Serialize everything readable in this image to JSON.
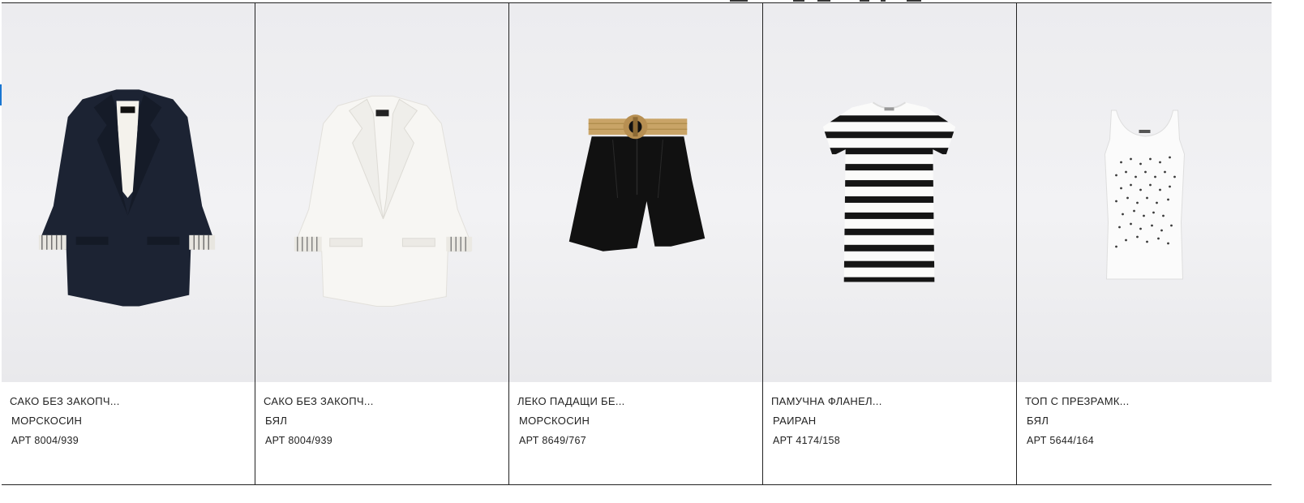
{
  "products": [
    {
      "name": "САКО БЕЗ ЗАКОПЧ...",
      "color": "МОРСКОСИН",
      "ref": "АРТ 8004/939",
      "image_icon": "navy-blazer-image"
    },
    {
      "name": "САКО БЕЗ ЗАКОПЧ...",
      "color": "БЯЛ",
      "ref": "АРТ 8004/939",
      "image_icon": "white-blazer-image"
    },
    {
      "name": "ЛЕКО ПАДАЩИ БЕ...",
      "color": "МОРСКОСИН",
      "ref": "АРТ 8649/767",
      "image_icon": "black-shorts-image"
    },
    {
      "name": "ПАМУЧНА ФЛАНЕЛ...",
      "color": "РАИРАН",
      "ref": "АРТ 4174/158",
      "image_icon": "striped-tshirt-image"
    },
    {
      "name": "ТОП С ПРЕЗРАМК...",
      "color": "БЯЛ",
      "ref": "АРТ 5644/164",
      "image_icon": "white-tank-top-image"
    }
  ],
  "colors": {
    "navy": "#1c2333",
    "white_garment": "#f7f6f3",
    "black": "#111111",
    "straw": "#c9a467",
    "accent": "#1976d2"
  }
}
